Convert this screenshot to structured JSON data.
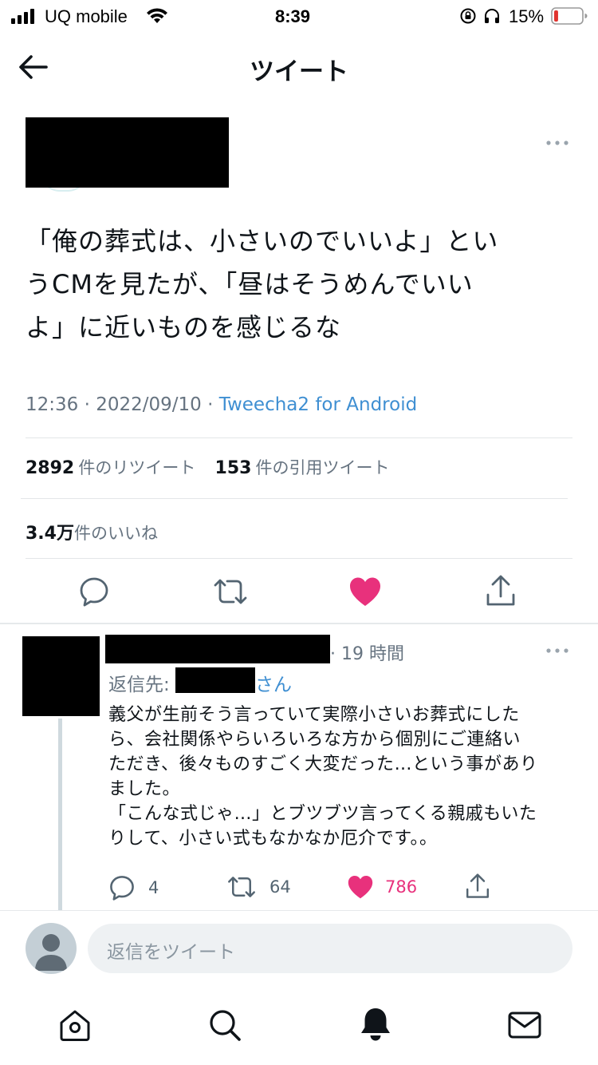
{
  "status_bar": {
    "carrier": "UQ mobile",
    "time": "8:39",
    "battery_percent": "15%",
    "battery_level": 0.15,
    "battery_color": "#e0342f"
  },
  "nav": {
    "title": "ツイート",
    "back_icon": "arrow-left-icon"
  },
  "tweet": {
    "text": "「俺の葬式は、小さいのでいいよ」という CMを見たが、「昼はそうめんでいいよ」に近いものを感じるな",
    "line1": "「俺の葬式は、小さいのでいいよ」とい",
    "line2": "うCMを見たが、「昼はそうめんでいい",
    "line3": "よ」に近いものを感じるな",
    "time": "12:36 · 2022/09/10 · ",
    "source": "Tweecha2 for Android",
    "retweet_count": "2892",
    "retweet_label": "件のリツイート",
    "quote_count": "153",
    "quote_label": "件の引用ツイート",
    "like_count": "3.4万",
    "like_label": "件のいいね"
  },
  "reply": {
    "time": "· 19 時間",
    "replying_prefix": "返信先:",
    "replying_suffix": "さん",
    "line1": "義父が生前そう言っていて実際小さいお葬式にした",
    "line2": "ら、会社関係やらいろいろな方から個別にご連絡い",
    "line3": "ただき、後々ものすごく大変だった…という事があり",
    "line4": "ました。",
    "line5": "「こんな式じゃ…」とブツブツ言ってくる親戚もいた",
    "line6": "りして、小さい式もなかなか厄介です。。",
    "reply_count": "4",
    "retweet_count": "64",
    "like_count": "786"
  },
  "composer": {
    "placeholder": "返信をツイート"
  },
  "colors": {
    "like": "#e8317c",
    "link": "#3f8fd2",
    "muted": "#667380"
  },
  "tabbar": [
    "home-icon",
    "search-icon",
    "notifications-icon",
    "messages-icon"
  ]
}
